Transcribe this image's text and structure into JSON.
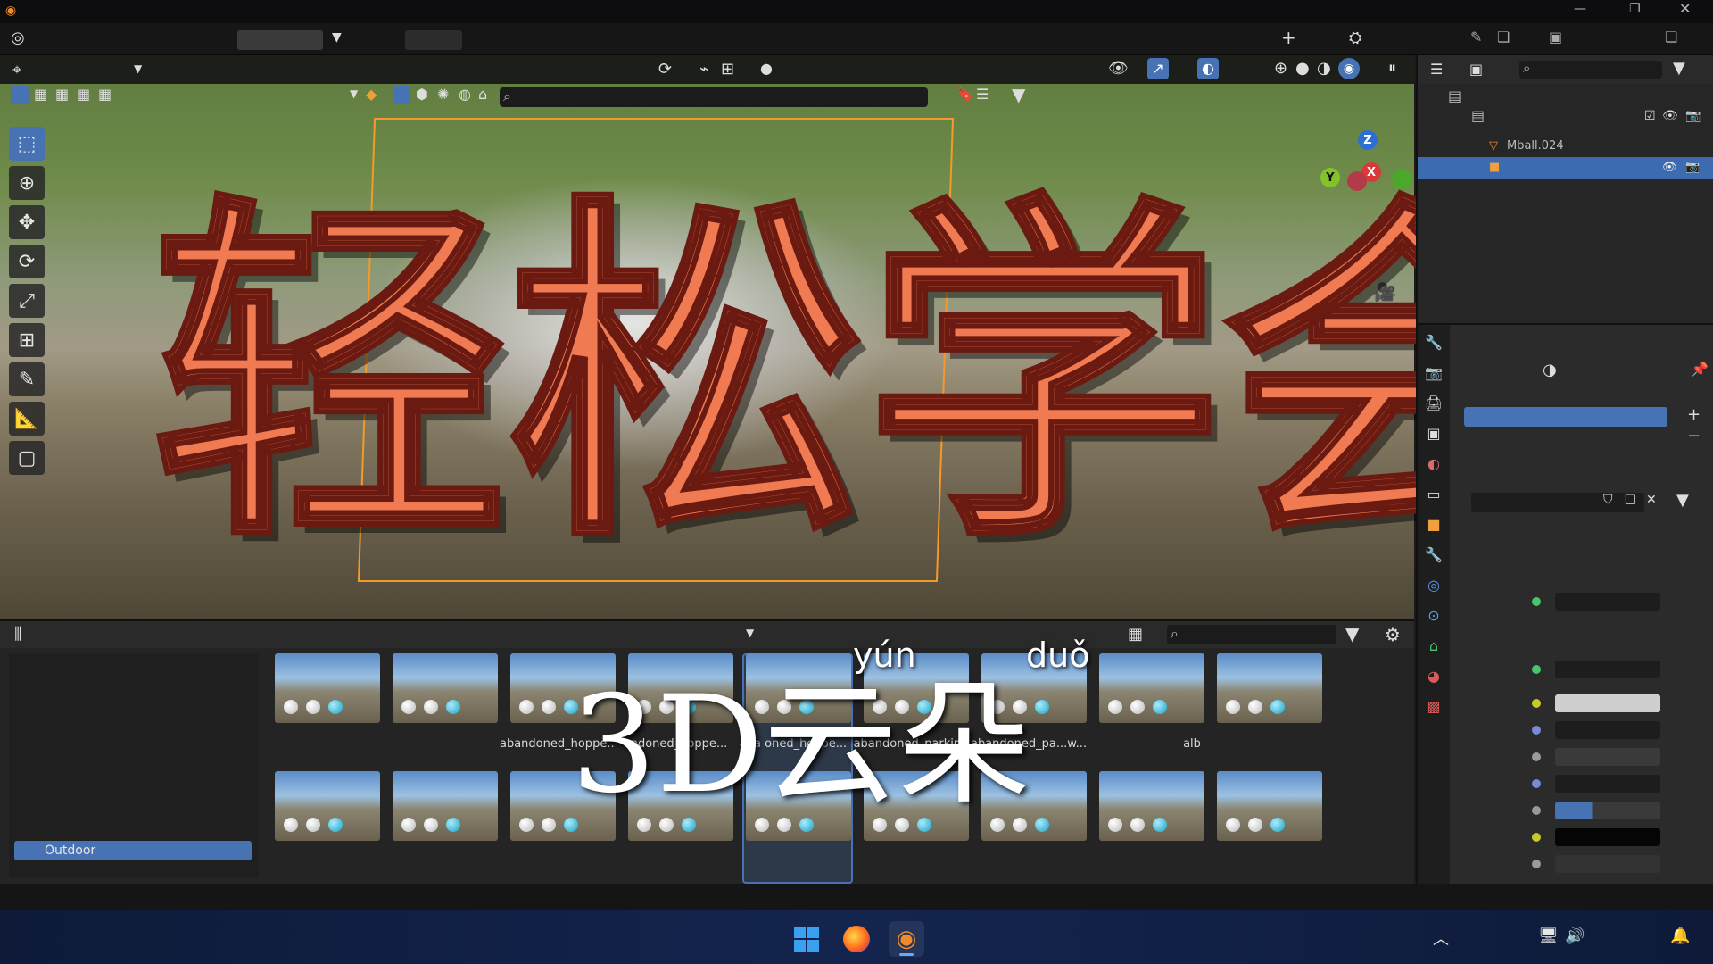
{
  "title_overlay": {
    "main": "轻松学会",
    "sub": "3D云朵",
    "pinyin_1": "yún",
    "pinyin_2": "duǒ"
  },
  "asset_browser": {
    "category_selected": "Outdoor",
    "labels": [
      "abandoned_hoppe...",
      "andoned_hoppe...",
      "aba   oned_hoppe...",
      "abandoned_parking",
      "abandoned_pa...w...",
      "alb"
    ]
  },
  "outliner": {
    "rows": [
      {
        "label": "Mball.024"
      },
      {
        "label": ""
      }
    ]
  },
  "colors": {
    "title_fill": "#f07a52",
    "title_stroke": "#6a1a10",
    "selection_blue": "#4772b3",
    "bbox_orange": "#f59a2a"
  },
  "icons": {
    "select": "select-box-icon",
    "cursor": "cursor-icon",
    "move": "move-icon",
    "rotate": "rotate-icon",
    "scale": "scale-icon",
    "transform": "transform-icon",
    "annotate": "annotate-icon",
    "measure": "measure-icon",
    "add_cube": "add-cube-icon"
  },
  "gizmo": {
    "z": "Z",
    "y": "Y",
    "x": "X"
  },
  "taskbar": {
    "start": "windows-start-icon",
    "firefox": "firefox-icon",
    "blender": "blender-icon"
  }
}
